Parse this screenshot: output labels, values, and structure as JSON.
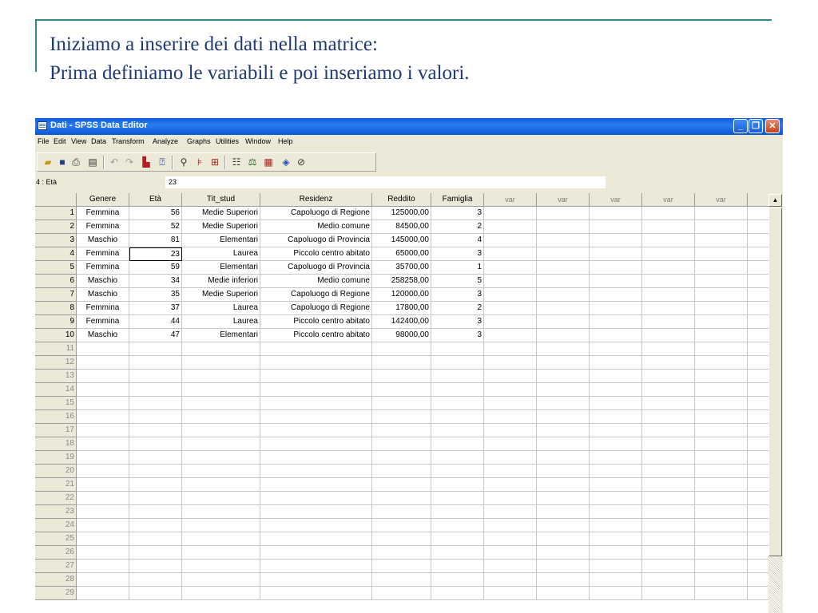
{
  "slide": {
    "line1": "Iniziamo a inserire dei dati nella matrice:",
    "line2": "Prima definiamo le variabili e poi inseriamo i valori."
  },
  "window": {
    "title": "Dati - SPSS Data Editor"
  },
  "menu": [
    "File",
    "Edit",
    "View",
    "Data",
    "Transform",
    "Analyze",
    "Graphs",
    "Utilities",
    "Window",
    "Help"
  ],
  "cell_editor": {
    "reference": "4 : Età",
    "value": "23"
  },
  "grid": {
    "columns": [
      "Genere",
      "Età",
      "Tit_stud",
      "Residenz",
      "Reddito",
      "Famiglia",
      "var",
      "var",
      "var",
      "var",
      "var"
    ],
    "rows": [
      [
        "1",
        "Femmina",
        "56",
        "Medie Superiori",
        "Capoluogo di Regione",
        "125000,00",
        "3"
      ],
      [
        "2",
        "Femmina",
        "52",
        "Medie Superiori",
        "Medio comune",
        "84500,00",
        "2"
      ],
      [
        "3",
        "Maschio",
        "81",
        "Elementari",
        "Capoluogo di Provincia",
        "145000,00",
        "4"
      ],
      [
        "4",
        "Femmina",
        "23",
        "Laurea",
        "Piccolo centro abitato",
        "65000,00",
        "3"
      ],
      [
        "5",
        "Femmina",
        "59",
        "Elementari",
        "Capoluogo di Provincia",
        "35700,00",
        "1"
      ],
      [
        "6",
        "Maschio",
        "34",
        "Medie inferiori",
        "Medio comune",
        "258258,00",
        "5"
      ],
      [
        "7",
        "Maschio",
        "35",
        "Medie Superiori",
        "Capoluogo di Regione",
        "120000,00",
        "3"
      ],
      [
        "8",
        "Femmina",
        "37",
        "Laurea",
        "Capoluogo di Regione",
        "17800,00",
        "2"
      ],
      [
        "9",
        "Femmina",
        "44",
        "Laurea",
        "Piccolo centro abitato",
        "142400,00",
        "3"
      ],
      [
        "10",
        "Maschio",
        "47",
        "Elementari",
        "Piccolo centro abitato",
        "98000,00",
        "3"
      ]
    ],
    "empty_rows": [
      "11",
      "12",
      "13",
      "14",
      "15",
      "16",
      "17",
      "18",
      "19",
      "20",
      "21",
      "22",
      "23",
      "24",
      "25",
      "26",
      "27",
      "28",
      "29"
    ]
  },
  "colors": {
    "slide_text": "#1f3a78",
    "slide_rule": "#2e8b8b",
    "titlebar": "#0a5fde"
  }
}
